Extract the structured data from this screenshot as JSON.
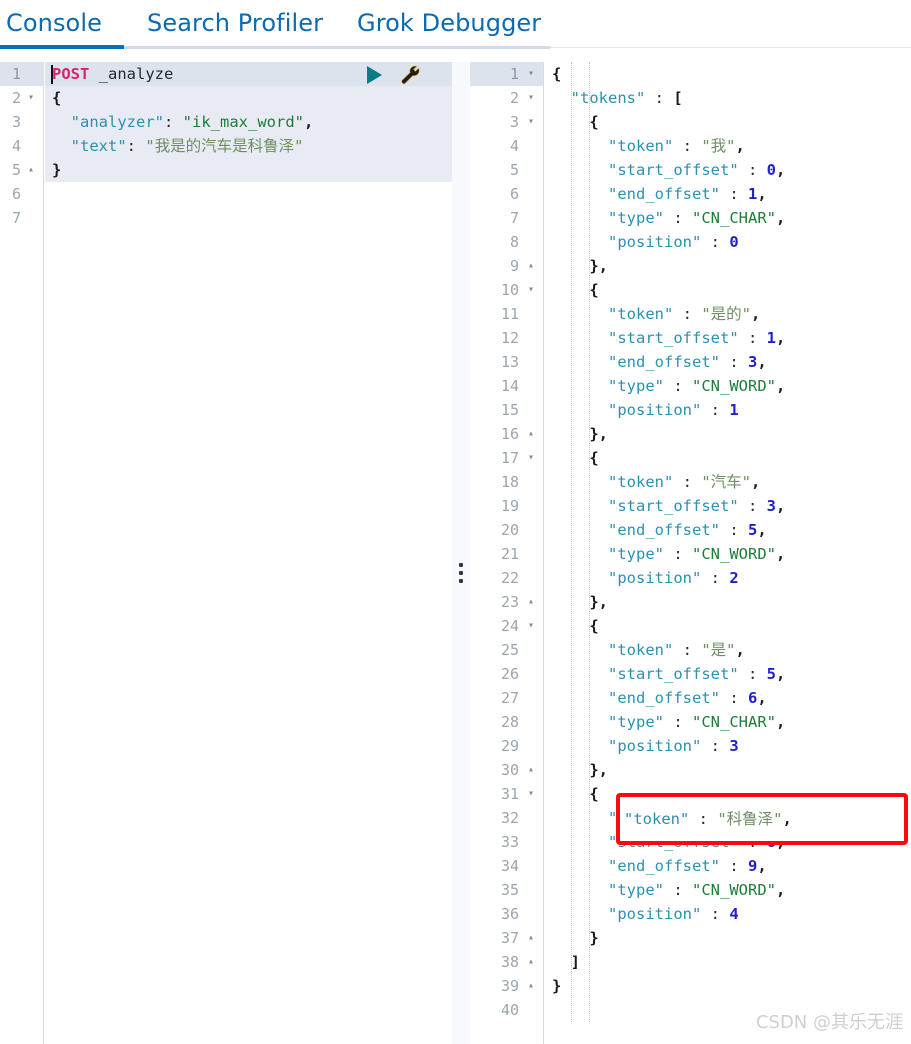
{
  "tabs": [
    {
      "label": "Console",
      "active": true
    },
    {
      "label": "Search Profiler",
      "active": false
    },
    {
      "label": "Grok Debugger",
      "active": false
    }
  ],
  "theme": {
    "accent": "#0071c2",
    "tab_text": "#0b6ab0",
    "key_color": "#2b91af",
    "string_color": "#1a7f37",
    "number_color": "#1f1fd0",
    "method_color": "#d6236f",
    "annotation_red": "#fa0a0a",
    "active_line_bg": "#dde3ec",
    "selection_bg": "#e8ebf3"
  },
  "request_editor": {
    "name": "console-request-editor",
    "run_icon": "play-icon",
    "wrench_icon": "wrench-icon",
    "total_lines": 7,
    "lines": [
      {
        "n": 1,
        "fold": "",
        "active": true,
        "hl": "top",
        "segs": [
          {
            "t": "POST",
            "c": "k-method"
          },
          {
            "t": " _analyze",
            "c": "k-url"
          }
        ]
      },
      {
        "n": 2,
        "fold": "▾",
        "active": false,
        "hl": "body",
        "segs": [
          {
            "t": "{",
            "c": "k-punc"
          }
        ]
      },
      {
        "n": 3,
        "fold": "",
        "active": false,
        "hl": "body",
        "segs": [
          {
            "t": "  ",
            "c": ""
          },
          {
            "t": "\"analyzer\"",
            "c": "k-key"
          },
          {
            "t": ": ",
            "c": "k-colon"
          },
          {
            "t": "\"ik_max_word\"",
            "c": "k-str"
          },
          {
            "t": ",",
            "c": "k-punc"
          }
        ]
      },
      {
        "n": 4,
        "fold": "",
        "active": false,
        "hl": "body",
        "segs": [
          {
            "t": "  ",
            "c": ""
          },
          {
            "t": "\"text\"",
            "c": "k-key"
          },
          {
            "t": ": ",
            "c": "k-colon"
          },
          {
            "t": "\"我是的汽车是科鲁泽\"",
            "c": "k-strcn"
          }
        ]
      },
      {
        "n": 5,
        "fold": "▴",
        "active": false,
        "hl": "body",
        "segs": [
          {
            "t": "}",
            "c": "k-punc"
          }
        ]
      },
      {
        "n": 6,
        "fold": "",
        "active": false,
        "hl": "",
        "segs": []
      },
      {
        "n": 7,
        "fold": "",
        "active": false,
        "hl": "",
        "segs": []
      }
    ]
  },
  "response_editor": {
    "name": "console-response-editor",
    "total_lines": 40,
    "lines": [
      {
        "n": 1,
        "fold": "▾",
        "active": true,
        "indent": 0,
        "segs": [
          {
            "t": "{",
            "c": "k-punc"
          }
        ]
      },
      {
        "n": 2,
        "fold": "▾",
        "active": false,
        "indent": 0,
        "segs": [
          {
            "t": "  ",
            "c": ""
          },
          {
            "t": "\"tokens\"",
            "c": "k-key"
          },
          {
            "t": " : ",
            "c": "k-colon"
          },
          {
            "t": "[",
            "c": "k-punc"
          }
        ]
      },
      {
        "n": 3,
        "fold": "▾",
        "active": false,
        "indent": 1,
        "segs": [
          {
            "t": "    ",
            "c": ""
          },
          {
            "t": "{",
            "c": "k-punc"
          }
        ]
      },
      {
        "n": 4,
        "fold": "",
        "active": false,
        "indent": 2,
        "segs": [
          {
            "t": "      ",
            "c": ""
          },
          {
            "t": "\"token\"",
            "c": "k-key"
          },
          {
            "t": " : ",
            "c": "k-colon"
          },
          {
            "t": "\"我\"",
            "c": "k-strcn"
          },
          {
            "t": ",",
            "c": "k-punc"
          }
        ]
      },
      {
        "n": 5,
        "fold": "",
        "active": false,
        "indent": 2,
        "segs": [
          {
            "t": "      ",
            "c": ""
          },
          {
            "t": "\"start_offset\"",
            "c": "k-key"
          },
          {
            "t": " : ",
            "c": "k-colon"
          },
          {
            "t": "0",
            "c": "k-num"
          },
          {
            "t": ",",
            "c": "k-punc"
          }
        ]
      },
      {
        "n": 6,
        "fold": "",
        "active": false,
        "indent": 2,
        "segs": [
          {
            "t": "      ",
            "c": ""
          },
          {
            "t": "\"end_offset\"",
            "c": "k-key"
          },
          {
            "t": " : ",
            "c": "k-colon"
          },
          {
            "t": "1",
            "c": "k-num"
          },
          {
            "t": ",",
            "c": "k-punc"
          }
        ]
      },
      {
        "n": 7,
        "fold": "",
        "active": false,
        "indent": 2,
        "segs": [
          {
            "t": "      ",
            "c": ""
          },
          {
            "t": "\"type\"",
            "c": "k-key"
          },
          {
            "t": " : ",
            "c": "k-colon"
          },
          {
            "t": "\"CN_CHAR\"",
            "c": "k-str"
          },
          {
            "t": ",",
            "c": "k-punc"
          }
        ]
      },
      {
        "n": 8,
        "fold": "",
        "active": false,
        "indent": 2,
        "segs": [
          {
            "t": "      ",
            "c": ""
          },
          {
            "t": "\"position\"",
            "c": "k-key"
          },
          {
            "t": " : ",
            "c": "k-colon"
          },
          {
            "t": "0",
            "c": "k-num"
          }
        ]
      },
      {
        "n": 9,
        "fold": "▴",
        "active": false,
        "indent": 1,
        "segs": [
          {
            "t": "    ",
            "c": ""
          },
          {
            "t": "},",
            "c": "k-punc"
          }
        ]
      },
      {
        "n": 10,
        "fold": "▾",
        "active": false,
        "indent": 1,
        "segs": [
          {
            "t": "    ",
            "c": ""
          },
          {
            "t": "{",
            "c": "k-punc"
          }
        ]
      },
      {
        "n": 11,
        "fold": "",
        "active": false,
        "indent": 2,
        "segs": [
          {
            "t": "      ",
            "c": ""
          },
          {
            "t": "\"token\"",
            "c": "k-key"
          },
          {
            "t": " : ",
            "c": "k-colon"
          },
          {
            "t": "\"是的\"",
            "c": "k-strcn"
          },
          {
            "t": ",",
            "c": "k-punc"
          }
        ]
      },
      {
        "n": 12,
        "fold": "",
        "active": false,
        "indent": 2,
        "segs": [
          {
            "t": "      ",
            "c": ""
          },
          {
            "t": "\"start_offset\"",
            "c": "k-key"
          },
          {
            "t": " : ",
            "c": "k-colon"
          },
          {
            "t": "1",
            "c": "k-num"
          },
          {
            "t": ",",
            "c": "k-punc"
          }
        ]
      },
      {
        "n": 13,
        "fold": "",
        "active": false,
        "indent": 2,
        "segs": [
          {
            "t": "      ",
            "c": ""
          },
          {
            "t": "\"end_offset\"",
            "c": "k-key"
          },
          {
            "t": " : ",
            "c": "k-colon"
          },
          {
            "t": "3",
            "c": "k-num"
          },
          {
            "t": ",",
            "c": "k-punc"
          }
        ]
      },
      {
        "n": 14,
        "fold": "",
        "active": false,
        "indent": 2,
        "segs": [
          {
            "t": "      ",
            "c": ""
          },
          {
            "t": "\"type\"",
            "c": "k-key"
          },
          {
            "t": " : ",
            "c": "k-colon"
          },
          {
            "t": "\"CN_WORD\"",
            "c": "k-str"
          },
          {
            "t": ",",
            "c": "k-punc"
          }
        ]
      },
      {
        "n": 15,
        "fold": "",
        "active": false,
        "indent": 2,
        "segs": [
          {
            "t": "      ",
            "c": ""
          },
          {
            "t": "\"position\"",
            "c": "k-key"
          },
          {
            "t": " : ",
            "c": "k-colon"
          },
          {
            "t": "1",
            "c": "k-num"
          }
        ]
      },
      {
        "n": 16,
        "fold": "▴",
        "active": false,
        "indent": 1,
        "segs": [
          {
            "t": "    ",
            "c": ""
          },
          {
            "t": "},",
            "c": "k-punc"
          }
        ]
      },
      {
        "n": 17,
        "fold": "▾",
        "active": false,
        "indent": 1,
        "segs": [
          {
            "t": "    ",
            "c": ""
          },
          {
            "t": "{",
            "c": "k-punc"
          }
        ]
      },
      {
        "n": 18,
        "fold": "",
        "active": false,
        "indent": 2,
        "segs": [
          {
            "t": "      ",
            "c": ""
          },
          {
            "t": "\"token\"",
            "c": "k-key"
          },
          {
            "t": " : ",
            "c": "k-colon"
          },
          {
            "t": "\"汽车\"",
            "c": "k-strcn"
          },
          {
            "t": ",",
            "c": "k-punc"
          }
        ]
      },
      {
        "n": 19,
        "fold": "",
        "active": false,
        "indent": 2,
        "segs": [
          {
            "t": "      ",
            "c": ""
          },
          {
            "t": "\"start_offset\"",
            "c": "k-key"
          },
          {
            "t": " : ",
            "c": "k-colon"
          },
          {
            "t": "3",
            "c": "k-num"
          },
          {
            "t": ",",
            "c": "k-punc"
          }
        ]
      },
      {
        "n": 20,
        "fold": "",
        "active": false,
        "indent": 2,
        "segs": [
          {
            "t": "      ",
            "c": ""
          },
          {
            "t": "\"end_offset\"",
            "c": "k-key"
          },
          {
            "t": " : ",
            "c": "k-colon"
          },
          {
            "t": "5",
            "c": "k-num"
          },
          {
            "t": ",",
            "c": "k-punc"
          }
        ]
      },
      {
        "n": 21,
        "fold": "",
        "active": false,
        "indent": 2,
        "segs": [
          {
            "t": "      ",
            "c": ""
          },
          {
            "t": "\"type\"",
            "c": "k-key"
          },
          {
            "t": " : ",
            "c": "k-colon"
          },
          {
            "t": "\"CN_WORD\"",
            "c": "k-str"
          },
          {
            "t": ",",
            "c": "k-punc"
          }
        ]
      },
      {
        "n": 22,
        "fold": "",
        "active": false,
        "indent": 2,
        "segs": [
          {
            "t": "      ",
            "c": ""
          },
          {
            "t": "\"position\"",
            "c": "k-key"
          },
          {
            "t": " : ",
            "c": "k-colon"
          },
          {
            "t": "2",
            "c": "k-num"
          }
        ]
      },
      {
        "n": 23,
        "fold": "▴",
        "active": false,
        "indent": 1,
        "segs": [
          {
            "t": "    ",
            "c": ""
          },
          {
            "t": "},",
            "c": "k-punc"
          }
        ]
      },
      {
        "n": 24,
        "fold": "▾",
        "active": false,
        "indent": 1,
        "segs": [
          {
            "t": "    ",
            "c": ""
          },
          {
            "t": "{",
            "c": "k-punc"
          }
        ]
      },
      {
        "n": 25,
        "fold": "",
        "active": false,
        "indent": 2,
        "segs": [
          {
            "t": "      ",
            "c": ""
          },
          {
            "t": "\"token\"",
            "c": "k-key"
          },
          {
            "t": " : ",
            "c": "k-colon"
          },
          {
            "t": "\"是\"",
            "c": "k-strcn"
          },
          {
            "t": ",",
            "c": "k-punc"
          }
        ]
      },
      {
        "n": 26,
        "fold": "",
        "active": false,
        "indent": 2,
        "segs": [
          {
            "t": "      ",
            "c": ""
          },
          {
            "t": "\"start_offset\"",
            "c": "k-key"
          },
          {
            "t": " : ",
            "c": "k-colon"
          },
          {
            "t": "5",
            "c": "k-num"
          },
          {
            "t": ",",
            "c": "k-punc"
          }
        ]
      },
      {
        "n": 27,
        "fold": "",
        "active": false,
        "indent": 2,
        "segs": [
          {
            "t": "      ",
            "c": ""
          },
          {
            "t": "\"end_offset\"",
            "c": "k-key"
          },
          {
            "t": " : ",
            "c": "k-colon"
          },
          {
            "t": "6",
            "c": "k-num"
          },
          {
            "t": ",",
            "c": "k-punc"
          }
        ]
      },
      {
        "n": 28,
        "fold": "",
        "active": false,
        "indent": 2,
        "segs": [
          {
            "t": "      ",
            "c": ""
          },
          {
            "t": "\"type\"",
            "c": "k-key"
          },
          {
            "t": " : ",
            "c": "k-colon"
          },
          {
            "t": "\"CN_CHAR\"",
            "c": "k-str"
          },
          {
            "t": ",",
            "c": "k-punc"
          }
        ]
      },
      {
        "n": 29,
        "fold": "",
        "active": false,
        "indent": 2,
        "segs": [
          {
            "t": "      ",
            "c": ""
          },
          {
            "t": "\"position\"",
            "c": "k-key"
          },
          {
            "t": " : ",
            "c": "k-colon"
          },
          {
            "t": "3",
            "c": "k-num"
          }
        ]
      },
      {
        "n": 30,
        "fold": "▴",
        "active": false,
        "indent": 1,
        "segs": [
          {
            "t": "    ",
            "c": ""
          },
          {
            "t": "},",
            "c": "k-punc"
          }
        ]
      },
      {
        "n": 31,
        "fold": "▾",
        "active": false,
        "indent": 1,
        "segs": [
          {
            "t": "    ",
            "c": ""
          },
          {
            "t": "{",
            "c": "k-punc"
          }
        ]
      },
      {
        "n": 32,
        "fold": "",
        "active": false,
        "indent": 2,
        "segs": [
          {
            "t": "      ",
            "c": ""
          },
          {
            "t": "\"token\"",
            "c": "k-key"
          },
          {
            "t": " : ",
            "c": "k-colon"
          },
          {
            "t": "\"科鲁泽\"",
            "c": "k-strcn"
          },
          {
            "t": ",",
            "c": "k-punc"
          }
        ]
      },
      {
        "n": 33,
        "fold": "",
        "active": false,
        "indent": 2,
        "segs": [
          {
            "t": "      ",
            "c": ""
          },
          {
            "t": "\"start_offset\"",
            "c": "k-key"
          },
          {
            "t": " : ",
            "c": "k-colon"
          },
          {
            "t": "6",
            "c": "k-num"
          },
          {
            "t": ",",
            "c": "k-punc"
          }
        ]
      },
      {
        "n": 34,
        "fold": "",
        "active": false,
        "indent": 2,
        "segs": [
          {
            "t": "      ",
            "c": ""
          },
          {
            "t": "\"end_offset\"",
            "c": "k-key"
          },
          {
            "t": " : ",
            "c": "k-colon"
          },
          {
            "t": "9",
            "c": "k-num"
          },
          {
            "t": ",",
            "c": "k-punc"
          }
        ]
      },
      {
        "n": 35,
        "fold": "",
        "active": false,
        "indent": 2,
        "segs": [
          {
            "t": "      ",
            "c": ""
          },
          {
            "t": "\"type\"",
            "c": "k-key"
          },
          {
            "t": " : ",
            "c": "k-colon"
          },
          {
            "t": "\"CN_WORD\"",
            "c": "k-str"
          },
          {
            "t": ",",
            "c": "k-punc"
          }
        ]
      },
      {
        "n": 36,
        "fold": "",
        "active": false,
        "indent": 2,
        "segs": [
          {
            "t": "      ",
            "c": ""
          },
          {
            "t": "\"position\"",
            "c": "k-key"
          },
          {
            "t": " : ",
            "c": "k-colon"
          },
          {
            "t": "4",
            "c": "k-num"
          }
        ]
      },
      {
        "n": 37,
        "fold": "▴",
        "active": false,
        "indent": 1,
        "segs": [
          {
            "t": "    ",
            "c": ""
          },
          {
            "t": "}",
            "c": "k-punc"
          }
        ]
      },
      {
        "n": 38,
        "fold": "▴",
        "active": false,
        "indent": 0,
        "segs": [
          {
            "t": "  ",
            "c": ""
          },
          {
            "t": "]",
            "c": "k-punc"
          }
        ]
      },
      {
        "n": 39,
        "fold": "▴",
        "active": false,
        "indent": 0,
        "segs": [
          {
            "t": "}",
            "c": "k-punc"
          }
        ]
      },
      {
        "n": 40,
        "fold": "",
        "active": false,
        "indent": 0,
        "segs": []
      }
    ]
  },
  "annotation": {
    "name": "red-highlight-box",
    "target_line": 32,
    "segs": [
      {
        "t": "\"token\"",
        "c": "k-key"
      },
      {
        "t": " : ",
        "c": "k-colon"
      },
      {
        "t": "\"科鲁泽\"",
        "c": "k-strcn"
      },
      {
        "t": ",",
        "c": "k-punc"
      }
    ]
  },
  "splitter": {
    "name": "pane-splitter",
    "handle": "drag-dots-icon"
  },
  "watermark": {
    "text": "CSDN @其乐无涯"
  }
}
